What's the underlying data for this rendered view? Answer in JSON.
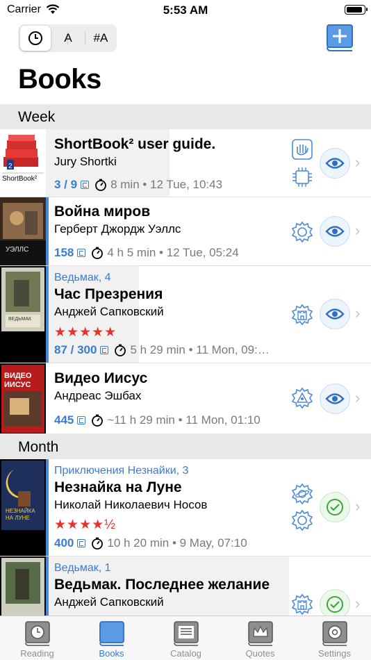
{
  "status": {
    "carrier": "Carrier",
    "time": "5:53 AM"
  },
  "sort": {
    "alpha_label": "A",
    "series_label": "#A",
    "selected": "recent"
  },
  "title": "Books",
  "sections": [
    {
      "label": "Week"
    },
    {
      "label": "Month"
    }
  ],
  "books": [
    {
      "series": "",
      "title": "ShortBook² user guide.",
      "author": "Jury Shortki",
      "rating": "",
      "pages": "3 / 9",
      "duration": "8 min",
      "date": "• 12 Tue, 10:43",
      "status": "reading",
      "cover_caption": "ShortBook²",
      "category_icons": [
        "hand-icon",
        "chip-icon"
      ]
    },
    {
      "series": "",
      "title": "Война миров",
      "author": "Герберт Джордж Уэллс",
      "rating": "",
      "pages": "158",
      "duration": "4 h 5 min",
      "date": "• 12 Tue, 05:24",
      "status": "reading",
      "cover_caption": "УЭЛЛС",
      "category_icons": [
        "gear-icon"
      ]
    },
    {
      "series": "Ведьмак, 4",
      "title": "Час Презрения",
      "author": "Анджей Сапковский",
      "rating": "★★★★★",
      "pages": "87 / 300",
      "duration": "5 h 29 min",
      "date": "• 11 Mon, 09:…",
      "status": "reading",
      "cover_caption": "ВЕДЬМАК",
      "category_icons": [
        "castle-icon"
      ]
    },
    {
      "series": "",
      "title": "Видео Иисус",
      "author": "Андреас Эшбах",
      "rating": "",
      "pages": "445",
      "duration": "~11 h 29 min",
      "date": "• 11 Mon, 01:10",
      "status": "reading",
      "cover_caption": "ВИДЕО ИИСУС",
      "category_icons": [
        "eye-triangle-icon"
      ]
    },
    {
      "series": "Приключения Незнайки, 3",
      "title": "Незнайка на Луне",
      "author": "Николай Николаевич Носов",
      "rating": "★★★★½",
      "pages": "400",
      "duration": "10 h 20 min",
      "date": "• 9 May, 07:10",
      "status": "finished",
      "cover_caption": "НЕЗНАЙКА НА ЛУНЕ",
      "category_icons": [
        "planet-icon",
        "gear-icon"
      ]
    },
    {
      "series": "Ведьмак, 1",
      "title": "Ведьмак. Последнее желание",
      "author": "Анджей Сапковский",
      "rating": "",
      "pages": "",
      "duration": "",
      "date": "",
      "status": "finished",
      "cover_caption": "",
      "category_icons": [
        "castle-icon"
      ]
    }
  ],
  "tabs": [
    {
      "label": "Reading",
      "active": false
    },
    {
      "label": "Books",
      "active": true
    },
    {
      "label": "Catalog",
      "active": false
    },
    {
      "label": "Quotes",
      "active": false
    },
    {
      "label": "Settings",
      "active": false
    }
  ],
  "colors": {
    "accent": "#3a7bd5",
    "rating": "#e8332b",
    "done": "#3aa83a",
    "section_bg": "#e8e8e8"
  }
}
